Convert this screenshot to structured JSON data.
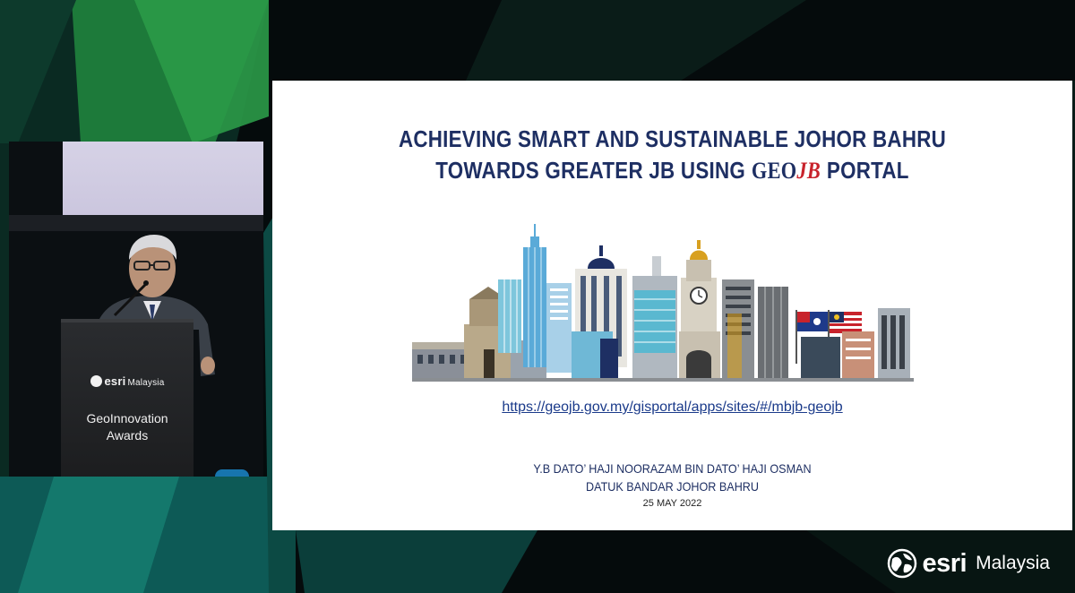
{
  "slide": {
    "title_line1": "ACHIEVING SMART AND SUSTAINABLE JOHOR BAHRU",
    "title_line2_prefix": "TOWARDS GREATER JB USING",
    "logo_geo": "GEO",
    "logo_jb": "JB",
    "title_line2_suffix": "PORTAL",
    "url": "https://geojb.gov.my/gisportal/apps/sites/#/mbjb-geojb",
    "presenter_name": "Y.B DATO’ HAJI NOORAZAM BIN DATO’ HAJI OSMAN",
    "presenter_role": "DATUK BANDAR JOHOR BAHRU",
    "date": "25 MAY 2022"
  },
  "podium": {
    "brand": "esri",
    "region": "Malaysia",
    "event_line1": "GeoInnovation",
    "event_line2": "Awards"
  },
  "watermark": {
    "brand": "esri",
    "region": "Malaysia"
  },
  "colors": {
    "title": "#1e2f63",
    "logo_accent": "#c8232c",
    "link": "#1a3a8a",
    "background_teal": "#0f6a5a",
    "background_green": "#1f8a3a"
  },
  "icons": [
    "esri-globe-icon",
    "skyline-illustration",
    "malaysia-flag-icon",
    "johor-flag-icon"
  ]
}
